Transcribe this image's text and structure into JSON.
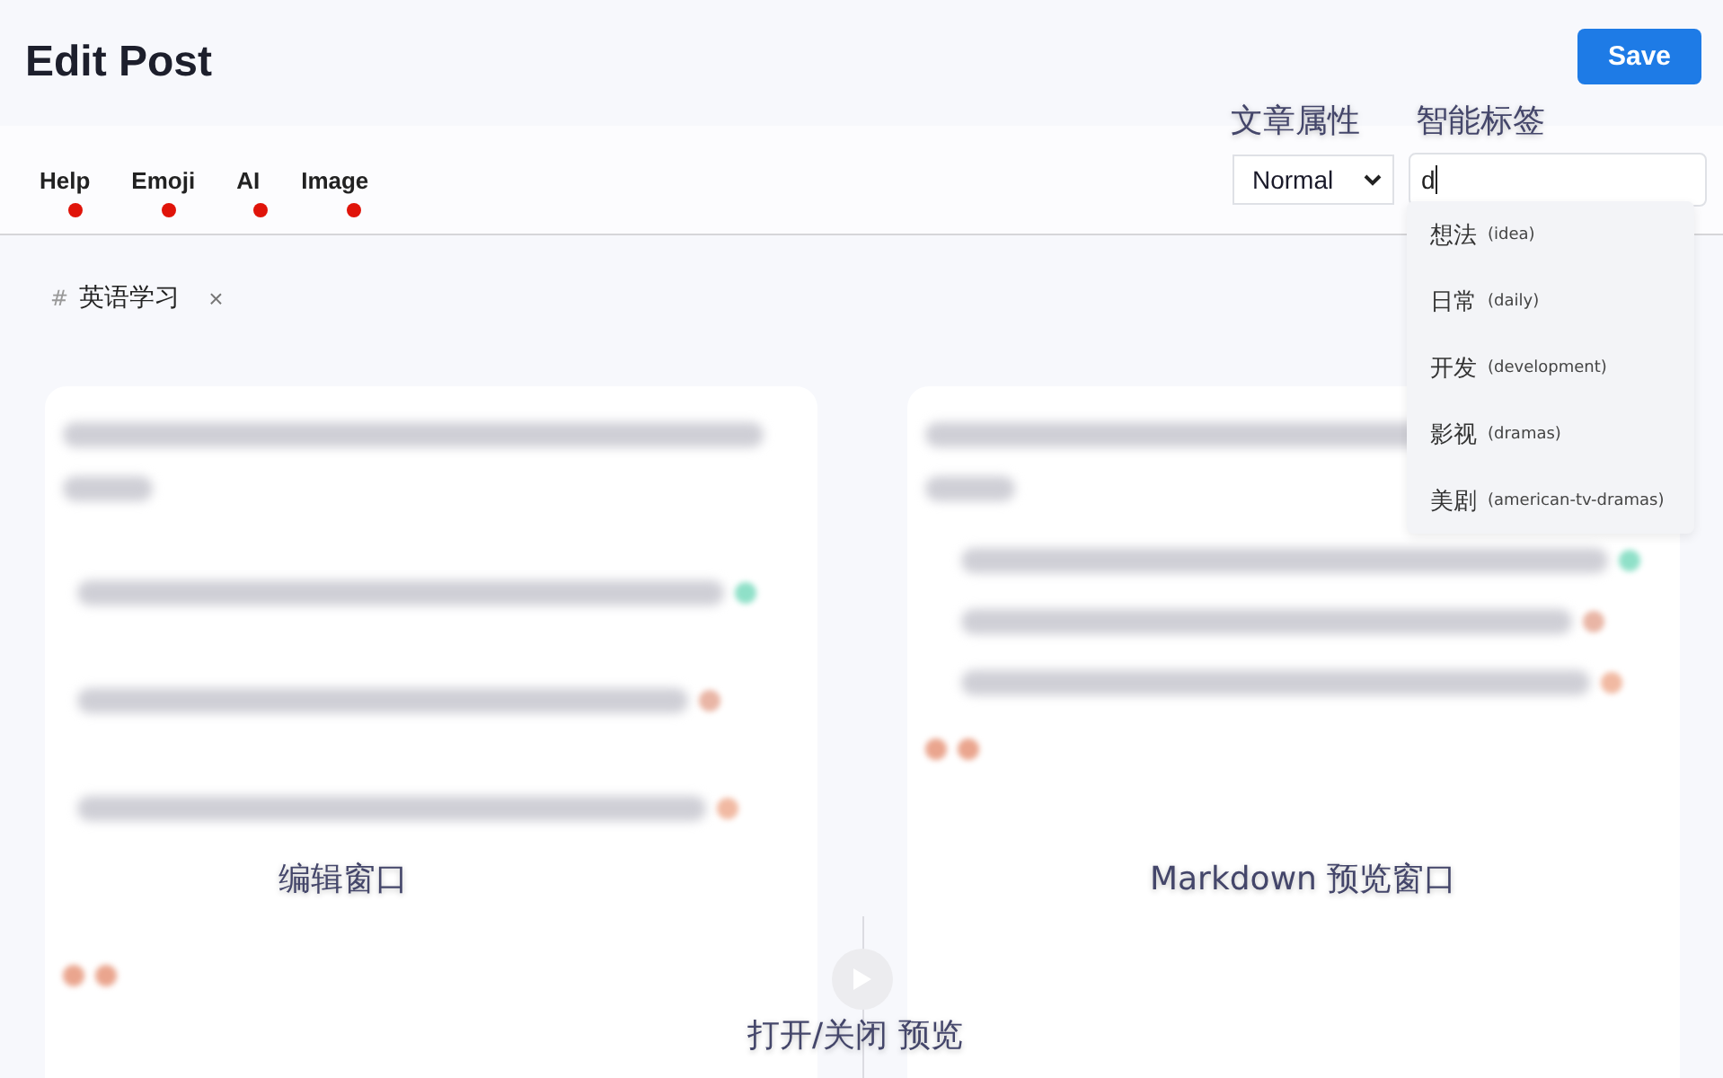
{
  "header": {
    "title": "Edit Post",
    "save_button": "Save"
  },
  "toolbar": {
    "items": [
      {
        "label": "Help"
      },
      {
        "label": "Emoji"
      },
      {
        "label": "AI"
      },
      {
        "label": "Image"
      }
    ]
  },
  "post_type": {
    "label": "文章属性",
    "value": "Normal"
  },
  "smart_tags": {
    "label": "智能标签",
    "value": "d",
    "suggestions": [
      {
        "name": "想法",
        "slug": "(idea)"
      },
      {
        "name": "日常",
        "slug": "(daily)"
      },
      {
        "name": "开发",
        "slug": "(development)"
      },
      {
        "name": "影视",
        "slug": "(dramas)"
      },
      {
        "name": "美剧",
        "slug": "(american-tv-dramas)"
      }
    ]
  },
  "tags": [
    {
      "hash": "#",
      "name": "英语学习",
      "remove": "×"
    }
  ],
  "annotations": {
    "editor": "编辑窗口",
    "preview": "Markdown 预览窗口",
    "toggle": "打开/关闭 预览"
  }
}
